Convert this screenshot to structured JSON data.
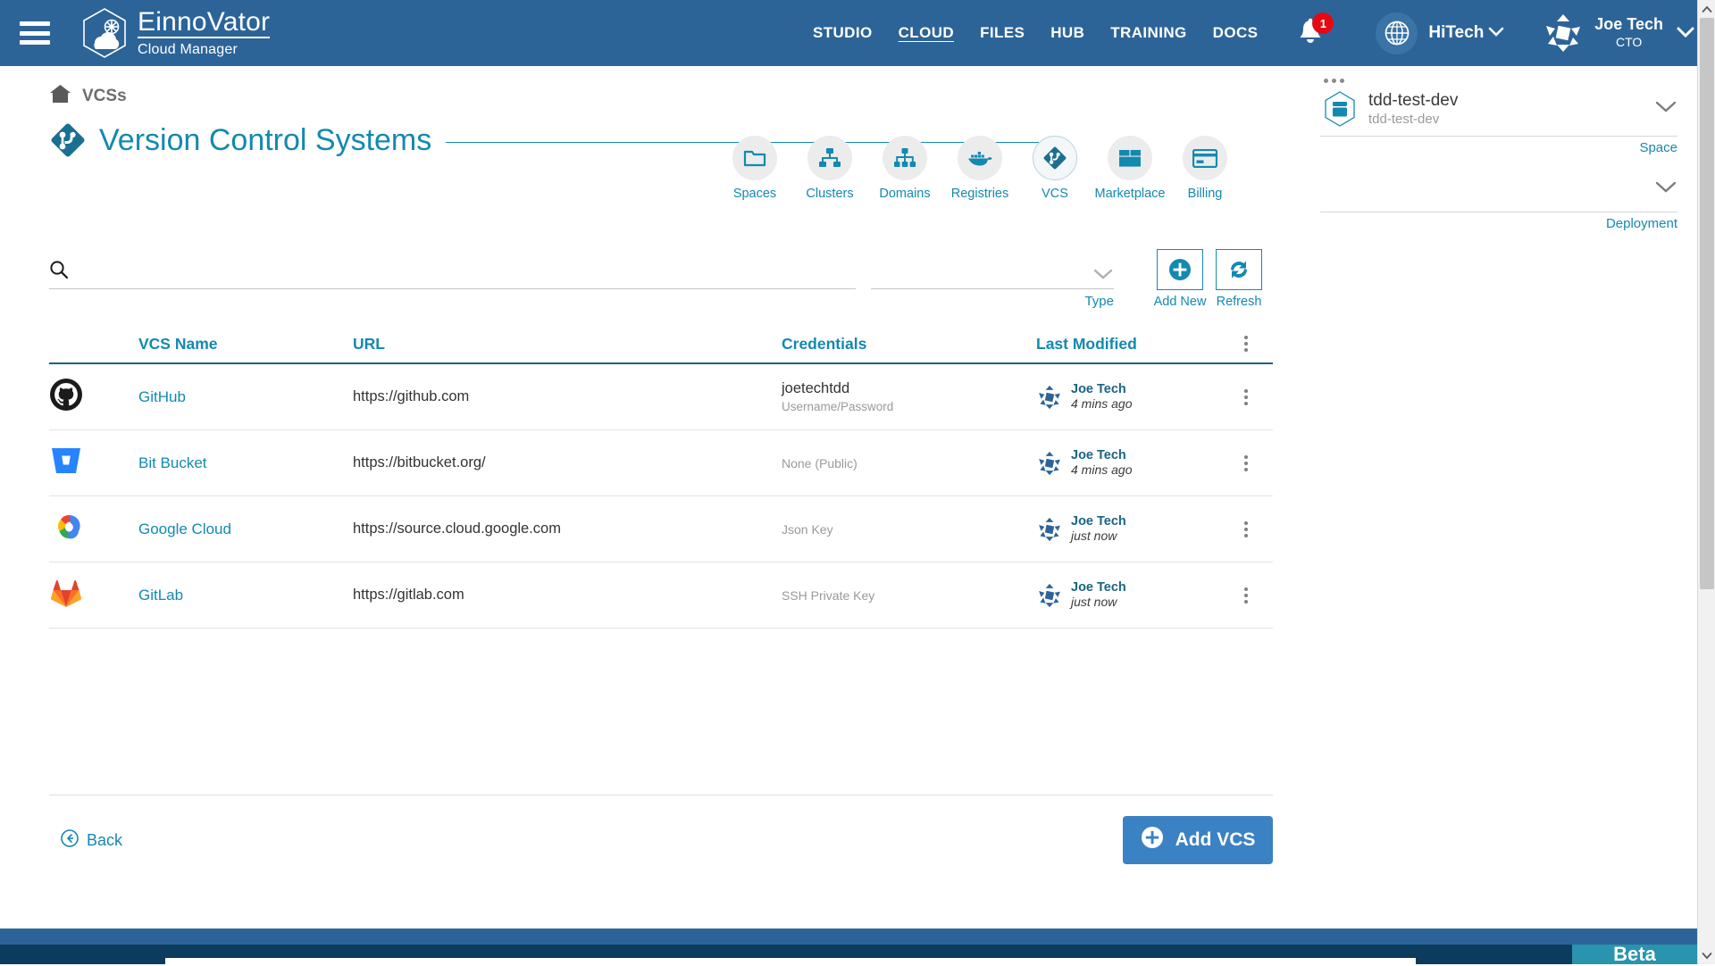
{
  "header": {
    "menu_icon": "hamburger-icon",
    "brand_name": "EinnoVator",
    "brand_sub": "Cloud Manager",
    "nav": [
      {
        "label": "STUDIO",
        "active": false
      },
      {
        "label": "CLOUD",
        "active": true
      },
      {
        "label": "FILES",
        "active": false
      },
      {
        "label": "HUB",
        "active": false
      },
      {
        "label": "TRAINING",
        "active": false
      },
      {
        "label": "DOCS",
        "active": false
      }
    ],
    "notification_icon": "bell-icon",
    "notification_count": "1",
    "org_icon": "globe-icon",
    "org_name": "HiTech",
    "user_name": "Joe Tech",
    "user_role": "CTO"
  },
  "breadcrumb": {
    "home_icon": "home-icon",
    "label": "VCSs"
  },
  "page_title": {
    "icon": "vcs-diamond-icon",
    "text": "Version Control Systems"
  },
  "toolbar": [
    {
      "label": "Spaces",
      "icon": "folder-icon",
      "selected": false
    },
    {
      "label": "Clusters",
      "icon": "cluster-icon",
      "selected": false
    },
    {
      "label": "Domains",
      "icon": "sitemap-icon",
      "selected": false
    },
    {
      "label": "Registries",
      "icon": "docker-whale-icon",
      "selected": false
    },
    {
      "label": "VCS",
      "icon": "vcs-diamond-icon",
      "selected": true
    },
    {
      "label": "Marketplace",
      "icon": "box-icon",
      "selected": false
    },
    {
      "label": "Billing",
      "icon": "credit-card-icon",
      "selected": false
    }
  ],
  "search": {
    "icon": "search-icon",
    "value": "",
    "placeholder": ""
  },
  "type_filter": {
    "value": "",
    "label": "Type",
    "chevron_icon": "chevron-down-icon"
  },
  "actions": [
    {
      "label": "Add New",
      "icon": "plus-circle-icon"
    },
    {
      "label": "Refresh",
      "icon": "refresh-icon"
    }
  ],
  "table": {
    "columns": [
      "VCS Name",
      "URL",
      "Credentials",
      "Last Modified"
    ],
    "header_menu_icon": "kebab-menu-icon",
    "rows": [
      {
        "logo": "github-icon",
        "name": "GitHub",
        "url": "https://github.com",
        "credential": "joetechtdd",
        "credential_type": "Username/Password",
        "modified_by": "Joe Tech",
        "modified_time": "4 mins ago",
        "menu_icon": "kebab-menu-icon"
      },
      {
        "logo": "bitbucket-icon",
        "name": "Bit Bucket",
        "url": "https://bitbucket.org/",
        "credential": "",
        "credential_type": "None (Public)",
        "modified_by": "Joe Tech",
        "modified_time": "4 mins ago",
        "menu_icon": "kebab-menu-icon"
      },
      {
        "logo": "google-cloud-icon",
        "name": "Google Cloud",
        "url": "https://source.cloud.google.com",
        "credential": "",
        "credential_type": "Json Key",
        "modified_by": "Joe Tech",
        "modified_time": "just now",
        "menu_icon": "kebab-menu-icon"
      },
      {
        "logo": "gitlab-icon",
        "name": "GitLab",
        "url": "https://gitlab.com",
        "credential": "",
        "credential_type": "SSH Private Key",
        "modified_by": "Joe Tech",
        "modified_time": "just now",
        "menu_icon": "kebab-menu-icon"
      }
    ]
  },
  "footer_actions": {
    "back_label": "Back",
    "back_icon": "arrow-left-circle-icon",
    "add_label": "Add VCS",
    "add_icon": "plus-circle-icon"
  },
  "side_panel": {
    "dots_icon": "more-dots-icon",
    "space": {
      "icon": "space-hex-icon",
      "title": "tdd-test-dev",
      "subtitle": "tdd-test-dev",
      "caption": "Space",
      "chevron_icon": "chevron-down-icon"
    },
    "deployment": {
      "title": "",
      "subtitle": "",
      "caption": "Deployment",
      "chevron_icon": "chevron-down-icon"
    }
  },
  "status_bar": {
    "beta_label": "Beta"
  },
  "colors": {
    "header_blue": "#2d6498",
    "accent_teal": "#1389b0",
    "rule_dark": "#1b6384",
    "badge_red": "#e50914",
    "button_blue": "#3b82c4"
  }
}
